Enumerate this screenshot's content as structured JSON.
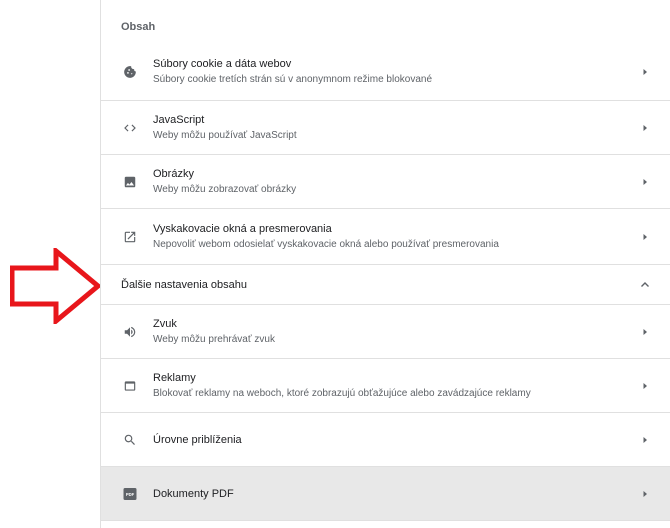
{
  "section": {
    "title": "Obsah"
  },
  "items": [
    {
      "icon": "cookie-icon",
      "title": "Súbory cookie a dáta webov",
      "subtitle": "Súbory cookie tretích strán sú v anonymnom režime blokované"
    },
    {
      "icon": "code-brackets-icon",
      "title": "JavaScript",
      "subtitle": "Weby môžu používať JavaScript"
    },
    {
      "icon": "image-icon",
      "title": "Obrázky",
      "subtitle": "Weby môžu zobrazovať obrázky"
    },
    {
      "icon": "open-in-new-icon",
      "title": "Vyskakovacie okná a presmerovania",
      "subtitle": "Nepovoliť webom odosielať vyskakovacie okná alebo používať presmerovania"
    }
  ],
  "more": {
    "label": "Ďalšie nastavenia obsahu",
    "expanded": true
  },
  "more_items": [
    {
      "icon": "speaker-icon",
      "title": "Zvuk",
      "subtitle": "Weby môžu prehrávať zvuk"
    },
    {
      "icon": "ads-window-icon",
      "title": "Reklamy",
      "subtitle": "Blokovať reklamy na weboch, ktoré zobrazujú obťažujúce alebo zavádzajúce reklamy"
    },
    {
      "icon": "search-icon",
      "title": "Úrovne priblíženia",
      "subtitle": ""
    },
    {
      "icon": "pdf-icon",
      "title": "Dokumenty PDF",
      "subtitle": "",
      "selected": true
    }
  ],
  "colors": {
    "icon": "#5f6368",
    "annotation_arrow": "#e8161b",
    "selected_row": "#e8e8e8",
    "divider": "#e0e0e0"
  }
}
